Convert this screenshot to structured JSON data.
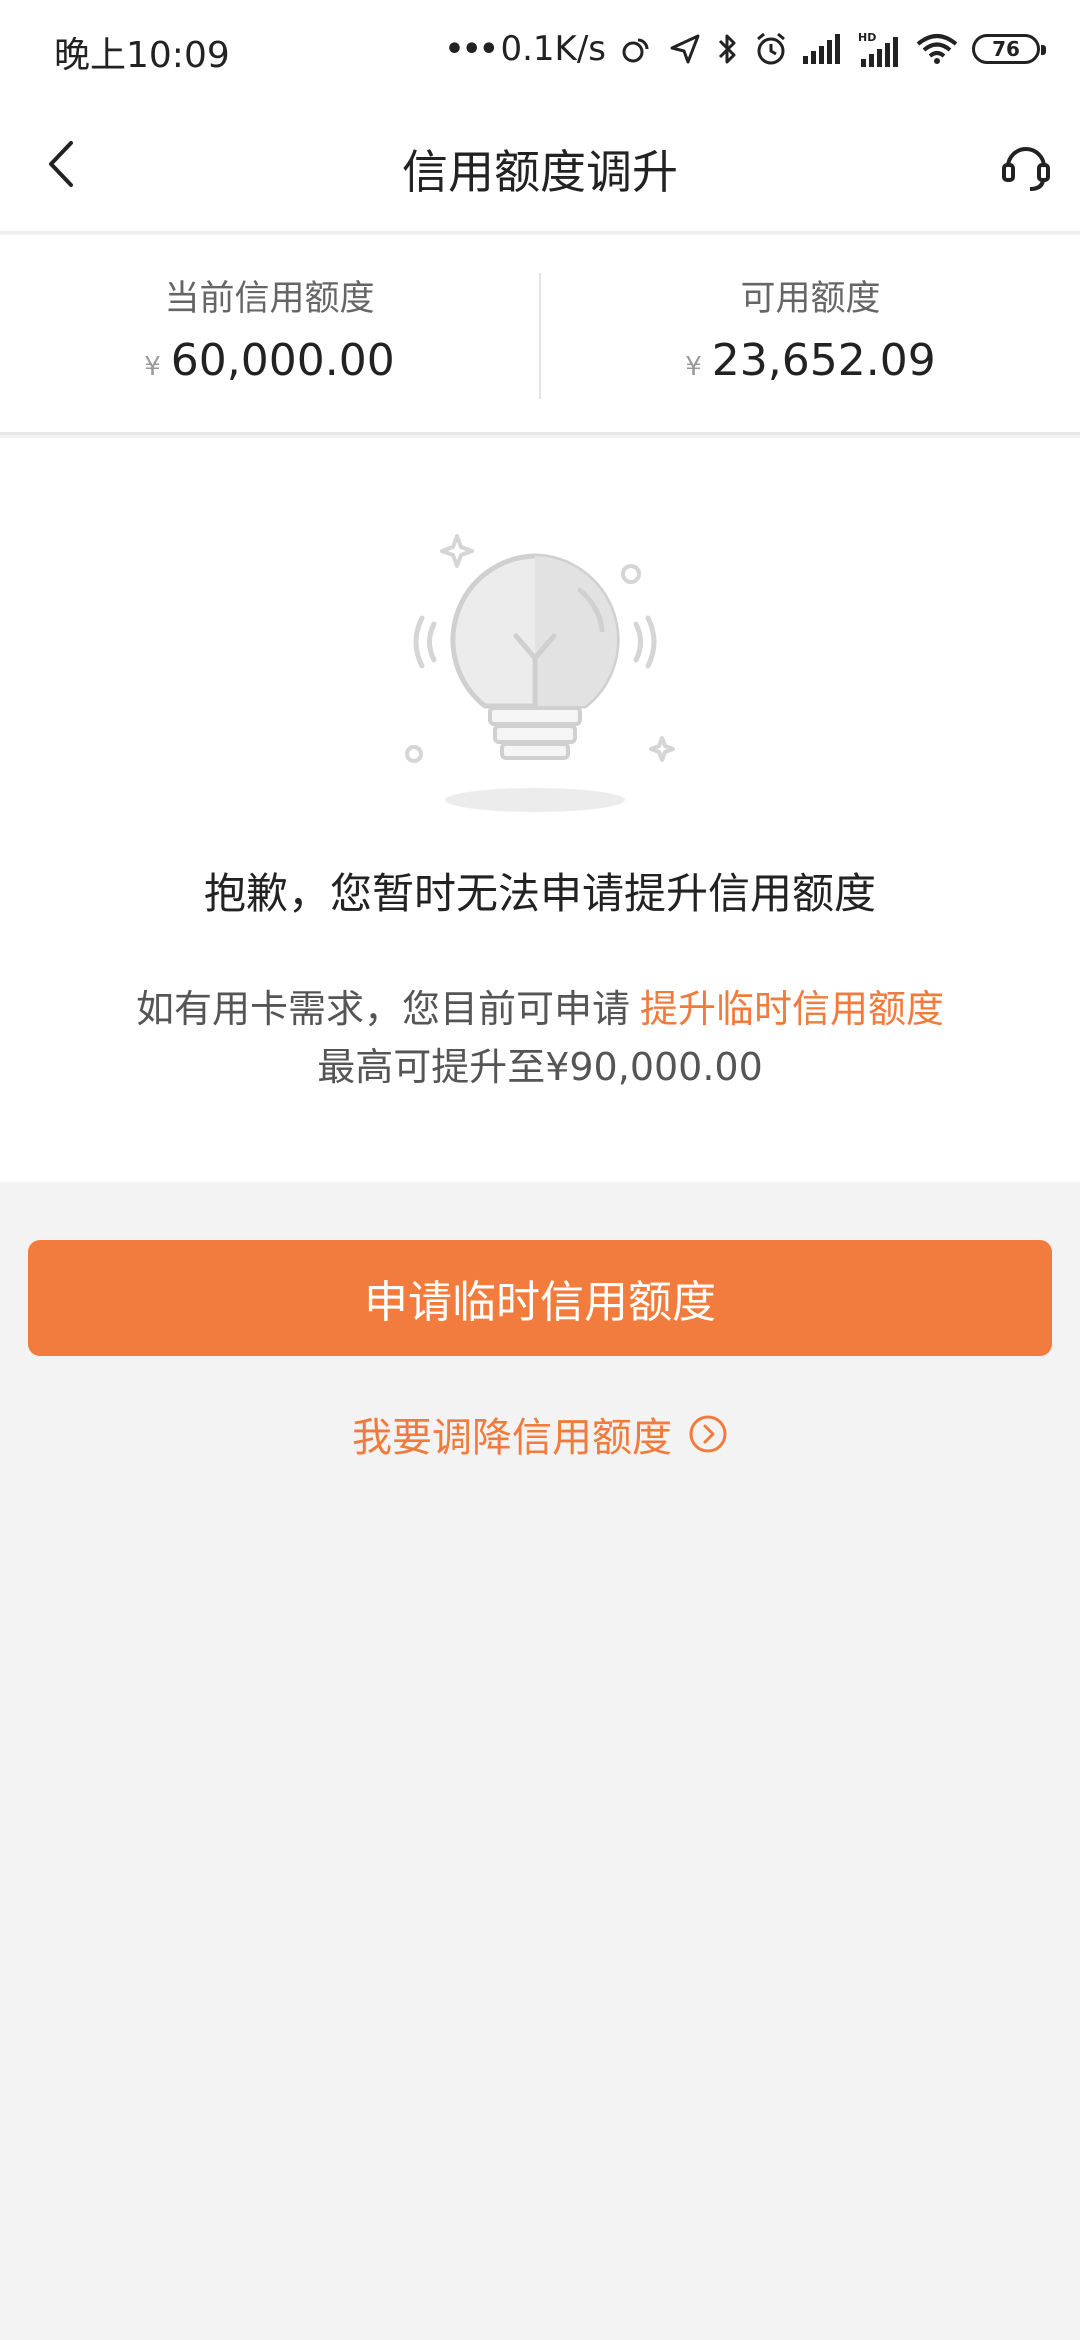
{
  "status_bar": {
    "time": "晚上10:09",
    "net_speed": "0.1K/s",
    "battery_level": "76",
    "icons": [
      "sync-icon",
      "location-icon",
      "bluetooth-icon",
      "alarm-icon",
      "signal-icon",
      "signal-hd-icon",
      "wifi-icon",
      "battery-icon"
    ]
  },
  "header": {
    "title": "信用额度调升",
    "back_icon": "chevron-left-icon",
    "service_icon": "headset-icon"
  },
  "limits": {
    "current": {
      "label": "当前信用额度",
      "currency": "¥",
      "amount": "60,000.00"
    },
    "available": {
      "label": "可用额度",
      "currency": "¥",
      "amount": "23,652.09"
    }
  },
  "notice": {
    "illustration": "lightbulb-icon",
    "title": "抱歉，您暂时无法申请提升信用额度",
    "line1_prefix": "如有用卡需求，您目前可申请",
    "line1_link": "提升临时信用额度",
    "line2": "最高可提升至¥90,000.00"
  },
  "actions": {
    "primary_label": "申请临时信用额度",
    "secondary_label": "我要调降信用额度",
    "secondary_icon": "circle-chevron-right-icon"
  },
  "colors": {
    "accent": "#f27c3e",
    "background": "#f3f3f3"
  }
}
